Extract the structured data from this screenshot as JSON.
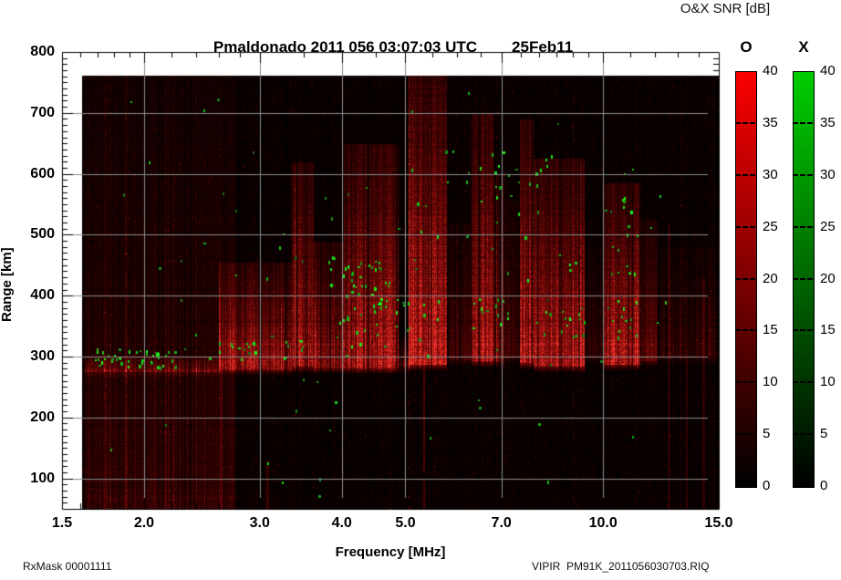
{
  "header": {
    "title": "Pmaldonado 2011 056 03:07:03 UTC",
    "date": "25Feb11",
    "colorbar_title": "O&X SNR [dB]"
  },
  "footer": {
    "rx_mask": "RxMask 00001111",
    "file_name": "VIPIR  PM91K_2011056030703.RIQ"
  },
  "chart_data": {
    "type": "heatmap",
    "title": "Pmaldonado 2011 056 03:07:03 UTC 25Feb11",
    "xlabel": "Frequency [MHz]",
    "ylabel": "Range [km]",
    "x_scale": "log",
    "x_range": [
      1.5,
      15.0
    ],
    "x_ticks": [
      1.5,
      2.0,
      3.0,
      4.0,
      5.0,
      7.0,
      10.0,
      15.0
    ],
    "x_tick_labels": [
      "1.5",
      "2.0",
      "3.0",
      "4.0",
      "5.0",
      "7.0",
      "10.0",
      "15.0"
    ],
    "y_range": [
      50,
      800
    ],
    "y_ticks": [
      800,
      700,
      600,
      500,
      400,
      300,
      200,
      100
    ],
    "y_minor_step_km": 10,
    "grid": true,
    "grid_color": "#8c8c8c",
    "frame_color": "#000000",
    "background_color": "#ffffff",
    "plot_background": "#000000",
    "signal_db_range": [
      0,
      40
    ],
    "colorbar_ticks": [
      40,
      35,
      30,
      25,
      20,
      15,
      10,
      5,
      0
    ],
    "colorbars": [
      {
        "label": "O",
        "top_color": "#fa0000",
        "bottom_color": "#000000"
      },
      {
        "label": "X",
        "top_color": "#00cc00",
        "bottom_color": "#000000"
      }
    ],
    "data_f_start_mhz": 1.62,
    "data_range_max_km": 762,
    "echo_bands": [
      {
        "f": [
          1.62,
          2.75
        ],
        "r": [
          50,
          762
        ],
        "db": 5
      },
      {
        "f": [
          1.62,
          2.6
        ],
        "r": [
          276,
          302
        ],
        "db": 11
      },
      {
        "f": [
          2.6,
          3.35
        ],
        "r": [
          280,
          455
        ],
        "db": 22
      },
      {
        "f": [
          3.35,
          3.62
        ],
        "r": [
          284,
          620
        ],
        "db": 24
      },
      {
        "f": [
          3.62,
          4.02
        ],
        "r": [
          282,
          490
        ],
        "db": 22
      },
      {
        "f": [
          4.02,
          4.88
        ],
        "r": [
          282,
          650
        ],
        "db": 26
      },
      {
        "f": [
          4.88,
          5.08
        ],
        "r": [
          284,
          330
        ],
        "db": 13
      },
      {
        "f": [
          5.05,
          5.78
        ],
        "r": [
          288,
          762
        ],
        "db": 30
      },
      {
        "f": [
          5.82,
          6.28
        ],
        "r": [
          295,
          520
        ],
        "db": 8
      },
      {
        "f": [
          6.3,
          6.82
        ],
        "r": [
          293,
          700
        ],
        "db": 24
      },
      {
        "f": [
          6.82,
          7.06
        ],
        "r": [
          293,
          600
        ],
        "db": 15
      },
      {
        "f": [
          7.08,
          7.44
        ],
        "r": [
          298,
          560
        ],
        "db": 7
      },
      {
        "f": [
          7.46,
          7.82
        ],
        "r": [
          290,
          690
        ],
        "db": 28
      },
      {
        "f": [
          7.82,
          9.35
        ],
        "r": [
          285,
          625
        ],
        "db": 27
      },
      {
        "f": [
          9.4,
          9.96
        ],
        "r": [
          298,
          480
        ],
        "db": 6
      },
      {
        "f": [
          10.0,
          11.38
        ],
        "r": [
          288,
          585
        ],
        "db": 27
      },
      {
        "f": [
          11.42,
          12.1
        ],
        "r": [
          294,
          525
        ],
        "db": 12
      },
      {
        "f": [
          12.15,
          14.9
        ],
        "r": [
          298,
          480
        ],
        "db": 5
      }
    ],
    "rfi_lines": [
      {
        "f": 2.62,
        "r": [
          55,
          290
        ],
        "db": 10
      },
      {
        "f": 3.08,
        "r": [
          60,
          130
        ],
        "db": 8
      },
      {
        "f": 5.33,
        "r": [
          120,
          310
        ],
        "db": 12
      },
      {
        "f": 5.33,
        "r": [
          55,
          100
        ],
        "db": 10
      },
      {
        "f": 12.55,
        "r": [
          60,
          520
        ],
        "db": 7
      },
      {
        "f": 13.4,
        "r": [
          60,
          300
        ],
        "db": 6
      },
      {
        "f": 14.2,
        "r": [
          60,
          430
        ],
        "db": 6
      }
    ],
    "x_mode_clusters": [
      {
        "f": [
          1.68,
          2.28
        ],
        "r": [
          283,
          315
        ],
        "count": 45
      },
      {
        "f": [
          2.5,
          3.02
        ],
        "r": [
          292,
          328
        ],
        "count": 12
      },
      {
        "f": [
          3.15,
          3.5
        ],
        "r": [
          296,
          332
        ],
        "count": 8
      },
      {
        "f": [
          3.8,
          4.78
        ],
        "r": [
          295,
          465
        ],
        "count": 42
      },
      {
        "f": [
          4.0,
          4.6
        ],
        "r": [
          380,
          460
        ],
        "count": 14
      },
      {
        "f": [
          4.8,
          5.65
        ],
        "r": [
          325,
          400
        ],
        "count": 12
      },
      {
        "f": [
          5.1,
          6.2
        ],
        "r": [
          495,
          645
        ],
        "count": 7
      },
      {
        "f": [
          6.3,
          7.2
        ],
        "r": [
          342,
          398
        ],
        "count": 14
      },
      {
        "f": [
          6.45,
          9.35
        ],
        "r": [
          425,
          645
        ],
        "count": 28
      },
      {
        "f": [
          7.8,
          9.35
        ],
        "r": [
          332,
          408
        ],
        "count": 16
      },
      {
        "f": [
          10.0,
          11.45
        ],
        "r": [
          332,
          400
        ],
        "count": 12
      },
      {
        "f": [
          10.0,
          11.3
        ],
        "r": [
          425,
          620
        ],
        "count": 18
      }
    ],
    "x_mode_scatter_count": 70
  }
}
